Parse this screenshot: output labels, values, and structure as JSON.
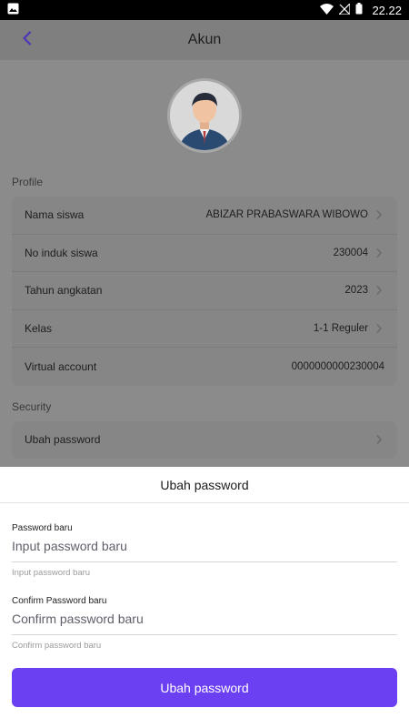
{
  "status_bar": {
    "time": "22.22"
  },
  "app_bar": {
    "title": "Akun"
  },
  "profile": {
    "section_label": "Profile",
    "rows": [
      {
        "label": "Nama siswa",
        "value": "ABIZAR PRABASWARA WIBOWO",
        "has_chevron": true
      },
      {
        "label": "No induk siswa",
        "value": "230004",
        "has_chevron": true
      },
      {
        "label": "Tahun angkatan",
        "value": "2023",
        "has_chevron": true
      },
      {
        "label": "Kelas",
        "value": "1-1 Reguler",
        "has_chevron": true
      },
      {
        "label": "Virtual account",
        "value": "0000000000230004",
        "has_chevron": false
      }
    ]
  },
  "security": {
    "section_label": "Security",
    "rows": [
      {
        "label": "Ubah password"
      }
    ]
  },
  "sheet": {
    "title": "Ubah password",
    "new_password": {
      "label": "Password baru",
      "placeholder": "Input password baru",
      "helper": "Input password baru"
    },
    "confirm_password": {
      "label": "Confirm Password baru",
      "placeholder": "Confirm password baru",
      "helper": "Confirm password baru"
    },
    "submit_label": "Ubah password"
  },
  "colors": {
    "accent": "#6b3ff2",
    "back_icon": "#5b3fd6"
  }
}
